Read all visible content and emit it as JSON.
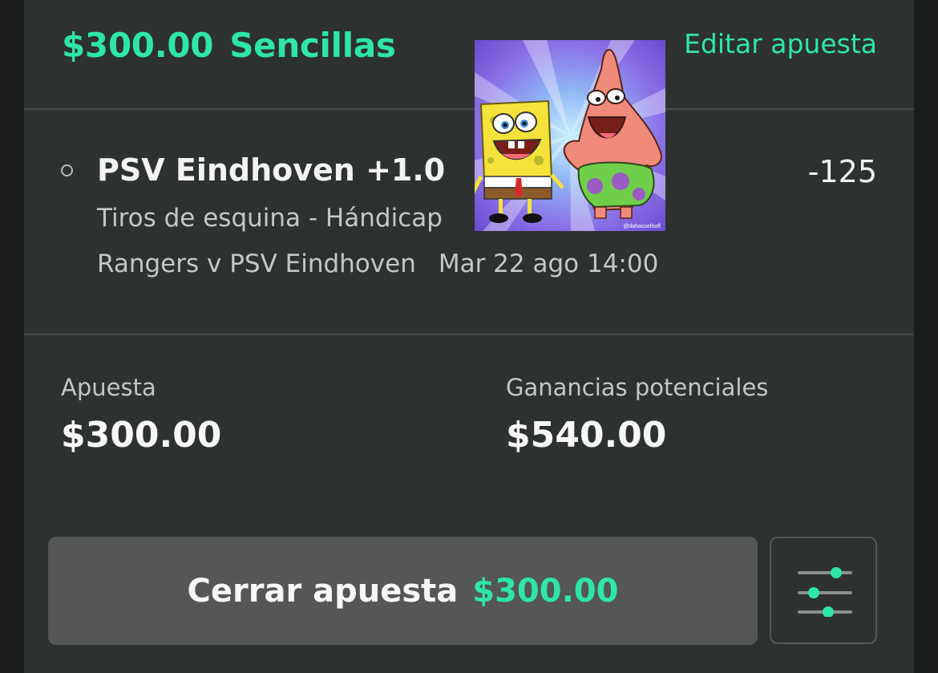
{
  "header": {
    "amount": "$300.00",
    "bet_type": "Sencillas",
    "edit_label": "Editar apuesta"
  },
  "selection": {
    "name": "PSV Eindhoven +1.0",
    "odds": "-125",
    "market": "Tiros de esquina - Hándicap",
    "event": "Rangers v PSV Eindhoven",
    "date": "Mar 22 ago 14:00"
  },
  "meme": {
    "watermark": "@dahasselhoff"
  },
  "summary": {
    "stake_label": "Apuesta",
    "stake_value": "$300.00",
    "winnings_label": "Ganancias potenciales",
    "winnings_value": "$540.00"
  },
  "actions": {
    "cash_out_label": "Cerrar apuesta",
    "cash_out_amount": "$300.00",
    "settings_icon": "sliders-icon"
  },
  "colors": {
    "accent": "#2ee6a6",
    "card": "#2d3230",
    "button": "#545756"
  }
}
